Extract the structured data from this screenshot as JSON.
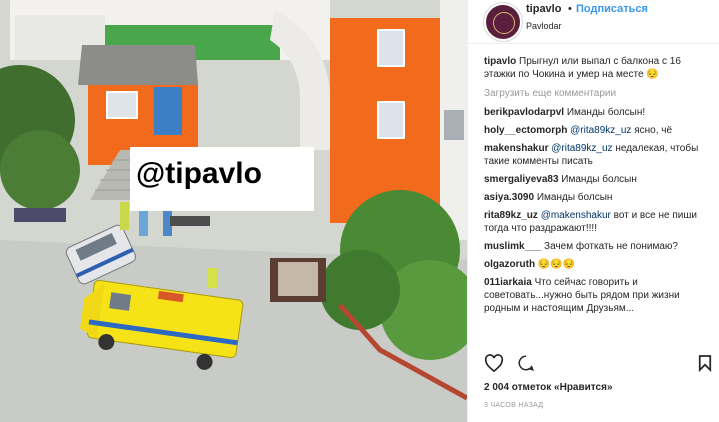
{
  "post": {
    "username": "tipavlo",
    "separator": "•",
    "follow": "Подписаться",
    "location": "Pavlodar",
    "watermark": "@tipavlo",
    "caption_user": "tipavlo",
    "caption_text": "Прыгнул или выпал с балкона с 16 этажки по Чокина и умер на месте",
    "caption_emoji": "😔",
    "load_more": "Загрузить еще комментарии",
    "comments": [
      {
        "user": "berikpavlodarpvl",
        "mention": "",
        "text": "Иманды болсын!"
      },
      {
        "user": "holy__ectomorph",
        "mention": "@rita89kz_uz",
        "text": "ясно, чё"
      },
      {
        "user": "makenshakur",
        "mention": "@rita89kz_uz",
        "text": "недалекая, чтобы такие комменты писать"
      },
      {
        "user": "smergaliyeva83",
        "mention": "",
        "text": "Иманды болсын"
      },
      {
        "user": "asiya.3090",
        "mention": "",
        "text": "Иманды болсын"
      },
      {
        "user": "rita89kz_uz",
        "mention": "@makenshakur",
        "text": "вот и все не пиши тогда что раздражают!!!!"
      },
      {
        "user": "muslimk___",
        "mention": "",
        "text": "Зачем фоткать не понимаю?"
      },
      {
        "user": "olgazoruth",
        "mention": "",
        "text": "😔😔😔"
      },
      {
        "user": "011iarkaia",
        "mention": "",
        "text": "Что сейчас говорить и советовать...нужно быть рядом при жизни родным и настоящим Друзьям..."
      }
    ],
    "likes": "2 004 отметок «Нравится»",
    "time": "3 ЧАСОВ НАЗАД"
  },
  "colors": {
    "link": "#3897f0",
    "text": "#262626",
    "muted": "#999999"
  },
  "icons": [
    "heart-icon",
    "comment-icon",
    "bookmark-icon"
  ]
}
